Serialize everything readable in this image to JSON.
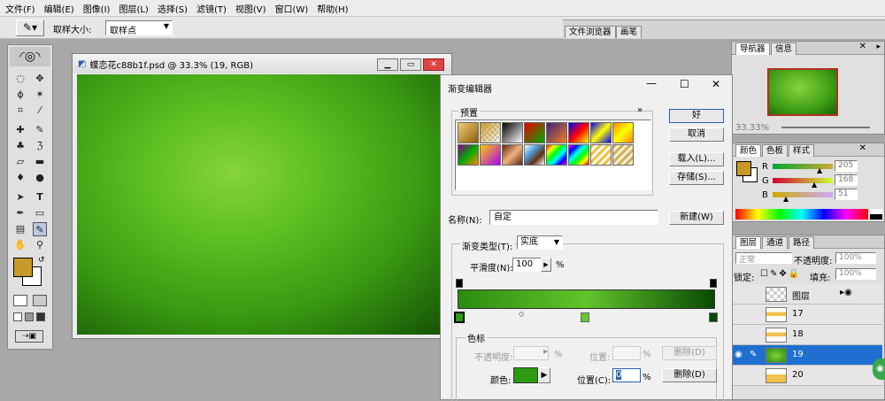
{
  "menu": [
    "文件(F)",
    "编辑(E)",
    "图像(I)",
    "图层(L)",
    "选择(S)",
    "滤镜(T)",
    "视图(V)",
    "窗口(W)",
    "帮助(H)"
  ],
  "options": {
    "sample_label": "取样大小:",
    "sample_value": "取样点",
    "tabs": [
      "文件浏览器",
      "画笔"
    ]
  },
  "document": {
    "title": "蝶恋花c88b1f.psd @ 33.3% (19, RGB)"
  },
  "colors": {
    "foreground": "#c89a2a",
    "background": "#ffffff",
    "selected_row": "#1e6fd0"
  },
  "dialog": {
    "title": "渐变编辑器",
    "presets_label": "预置",
    "more": "»",
    "ok": "好",
    "cancel": "取消",
    "load": "载入(L)...",
    "save": "存储(S)...",
    "name_label": "名称(N):",
    "name_value": "自定",
    "new": "新建(W)",
    "type_label": "渐变类型(T):",
    "type_value": "实底",
    "smooth_label": "平滑度(N):",
    "smooth_value": "100",
    "percent": "%",
    "stops_label": "色标",
    "opacity_label": "不透明度:",
    "location_label": "位置:",
    "delete": "删除(D)",
    "color_label": "颜色:",
    "position_label": "位置(C):",
    "position_value": "0"
  },
  "navigator": {
    "tabs": [
      "导航器",
      "信息"
    ],
    "zoom": "33.33%"
  },
  "color_panel": {
    "tabs": [
      "颜色",
      "色板",
      "样式"
    ],
    "r_label": "R",
    "r_value": "205",
    "g_label": "G",
    "g_value": "168",
    "b_label": "B",
    "b_value": "51"
  },
  "layers_panel": {
    "tabs": [
      "图层",
      "通道",
      "路径"
    ],
    "mode": "正常",
    "opacity_label": "不透明度:",
    "opacity_value": "100%",
    "lock_label": "锁定:",
    "fill_label": "填充:",
    "fill_value": "100%",
    "layers": [
      {
        "name": "图层"
      },
      {
        "name": "17"
      },
      {
        "name": "18"
      },
      {
        "name": "19"
      },
      {
        "name": "20"
      }
    ]
  }
}
